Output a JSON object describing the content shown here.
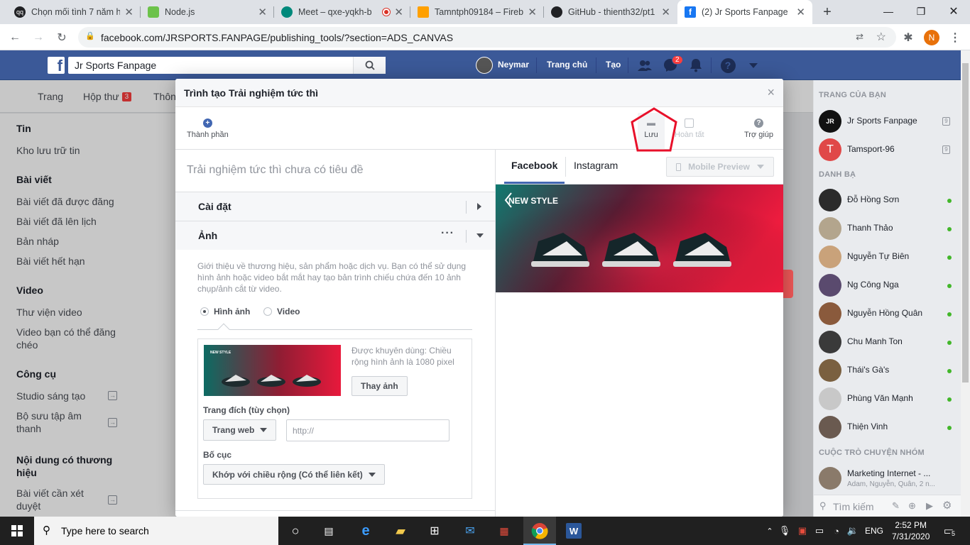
{
  "browser": {
    "tabs": [
      {
        "title": "Chọn mối tình 7 năm h",
        "favicon_color": "#202124",
        "favicon": "qq"
      },
      {
        "title": "Node.js",
        "favicon_color": "#6cc24a",
        "favicon": ""
      },
      {
        "title": "Meet – qxe-yqkh-b",
        "favicon_color": "#00897b",
        "favicon": ""
      },
      {
        "title": "Tamntph09184 – Fireba",
        "favicon_color": "#ffa000",
        "favicon": ""
      },
      {
        "title": "GitHub - thienth32/pt1",
        "favicon_color": "#202124",
        "favicon": ""
      },
      {
        "title": "(2) Jr Sports Fanpage",
        "favicon_color": "#1877f2",
        "favicon": "f"
      }
    ],
    "url": "facebook.com/JRSPORTS.FANPAGE/publishing_tools/?section=ADS_CANVAS",
    "profile_initial": "N",
    "profile_color": "#e8710a"
  },
  "fb_header": {
    "search_value": "Jr Sports Fanpage",
    "user_name": "Neymar",
    "home": "Trang chủ",
    "create": "Tạo",
    "messenger_badge": "2"
  },
  "page_tabs": {
    "page": "Trang",
    "inbox": "Hộp thư",
    "inbox_badge": "3",
    "notif": "Thôn"
  },
  "left_nav": {
    "sec_tin": "Tin",
    "kho_luu_tru": "Kho lưu trữ tin",
    "sec_bai_viet": "Bài viết",
    "published": "Bài viết đã được đăng",
    "scheduled": "Bài viết đã lên lịch",
    "drafts": "Bản nháp",
    "expired": "Bài viết hết hạn",
    "sec_video": "Video",
    "video_library": "Thư viện video",
    "crosspost_l1": "Video bạn có thể đăng",
    "crosspost_l2": "chéo",
    "sec_tools": "Công cụ",
    "creator_studio": "Studio sáng tạo",
    "sound_l1": "Bộ sưu tập âm",
    "sound_l2": "thanh",
    "sec_branded_l1": "Nội dung có thương",
    "sec_branded_l2": "hiệu",
    "review_l1": "Bài viết cần xét",
    "review_l2": "duyệt"
  },
  "right_bar": {
    "your_pages": "TRANG CỦA BẠN",
    "pages": [
      {
        "name": "Jr Sports Fanpage",
        "avatar_color": "#111111",
        "avatar_text": "JR"
      },
      {
        "name": "Tamsport-96",
        "avatar_color": "#e04848",
        "avatar_text": "T"
      }
    ],
    "contacts_title": "DANH BẠ",
    "contacts": [
      {
        "name": "Đỗ Hồng Sơn",
        "avatar_color": "#2b2b2b"
      },
      {
        "name": "Thanh Thảo",
        "avatar_color": "#b3a58d"
      },
      {
        "name": "Nguyễn Tự Biên",
        "avatar_color": "#c9a27a"
      },
      {
        "name": "Ng Công Nga",
        "avatar_color": "#5a4a6e"
      },
      {
        "name": "Nguyễn Hồng Quân",
        "avatar_color": "#8a5a3c"
      },
      {
        "name": "Chu Manh Ton",
        "avatar_color": "#3a3a3a"
      },
      {
        "name": "Thái's Gà's",
        "avatar_color": "#7a6040"
      },
      {
        "name": "Phùng Văn Mạnh",
        "avatar_color": "#c8c8c8"
      },
      {
        "name": "Thiện Vinh",
        "avatar_color": "#6a5a50"
      }
    ],
    "group_title": "CUỘC TRÒ CHUYỆN NHÓM",
    "group_name": "Marketing Internet - ...",
    "group_members": "Adam, Nguyễn, Quân, 2 n...",
    "search_placeholder": "Tìm kiếm"
  },
  "modal": {
    "title": "Trình tạo Trải nghiệm tức thì",
    "tool_components": "Thành phần",
    "tool_save": "Lưu",
    "tool_finish": "Hoàn tất",
    "tool_help": "Trợ giúp",
    "untitled": "Trải nghiệm tức thì chưa có tiêu đề",
    "settings": "Cài đặt",
    "photo": "Ảnh",
    "description": "Giới thiệu về thương hiệu, sản phẩm hoặc dịch vụ. Bạn có thể sử dụng hình ảnh hoặc video bắt mắt hay tạo bản trình chiếu chứa đến 10 ảnh chụp/ảnh cắt từ video.",
    "radio_image": "Hình ảnh",
    "radio_video": "Video",
    "selected_media": "Hình ảnh",
    "recommend": "Được khuyên dùng: Chiều rộng hình ảnh là 1080 pixel",
    "change_photo": "Thay ảnh",
    "dest_label": "Trang đích (tùy chọn)",
    "dest_type": "Trang web",
    "url_placeholder": "http://",
    "layout_label": "Bố cục",
    "layout_value": "Khớp với chiều rộng (Có thể liên kết)",
    "preview_fb": "Facebook",
    "preview_ig": "Instagram",
    "mobile_preview": "Mobile Preview",
    "banner_text": "NEW STYLE",
    "thumb_text": "NEW STYLE"
  },
  "taskbar": {
    "search_placeholder": "Type here to search",
    "time": "2:52 PM",
    "date": "7/31/2020",
    "lang": "ENG",
    "notif_count": "5"
  }
}
